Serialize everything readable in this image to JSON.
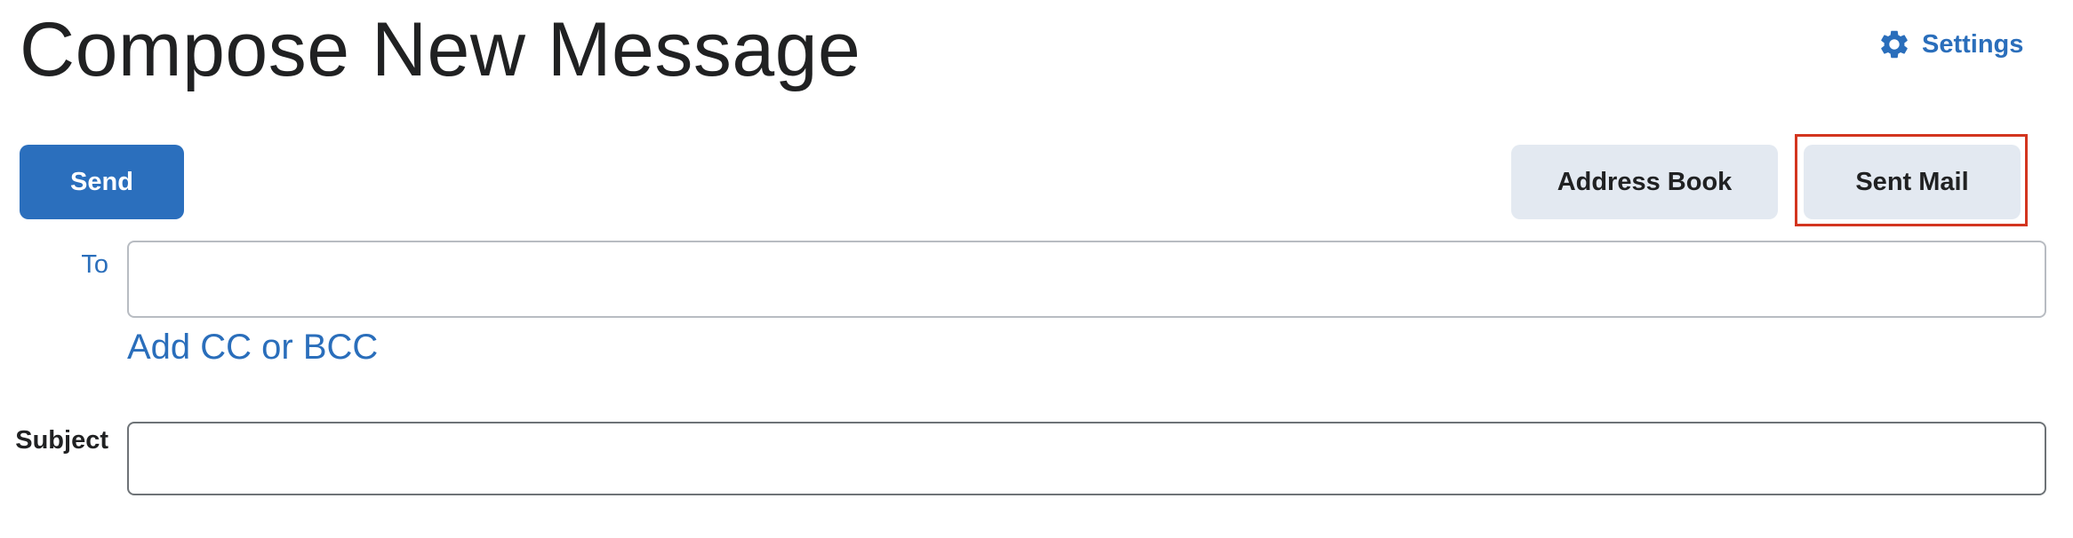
{
  "header": {
    "title": "Compose New Message",
    "settings_label": "Settings",
    "settings_icon": "gear-icon"
  },
  "toolbar": {
    "send_label": "Send",
    "address_book_label": "Address Book",
    "sent_mail_label": "Sent Mail"
  },
  "form": {
    "to_label": "To",
    "to_value": "",
    "add_cc_bcc_label": "Add CC or BCC",
    "subject_label": "Subject",
    "subject_value": ""
  },
  "colors": {
    "accent": "#2b6fbd",
    "link": "#2a6ebb",
    "secondary_button": "#e3e9f1",
    "highlight": "#d3351f"
  }
}
